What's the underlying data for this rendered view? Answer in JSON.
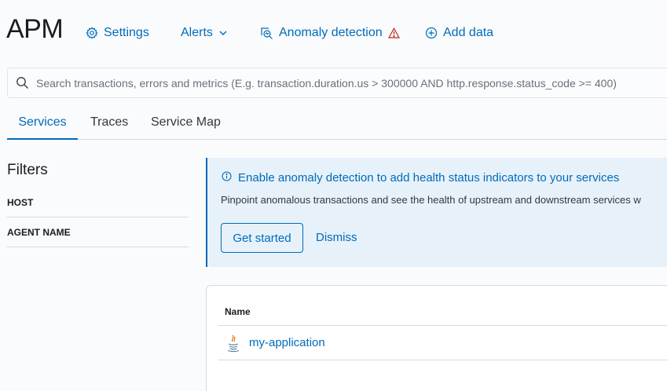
{
  "header": {
    "title": "APM",
    "nav": {
      "settings": "Settings",
      "alerts": "Alerts",
      "anomaly_detection": "Anomaly detection",
      "add_data": "Add data"
    }
  },
  "search": {
    "placeholder": "Search transactions, errors and metrics (E.g. transaction.duration.us > 300000 AND http.response.status_code >= 400)",
    "value": ""
  },
  "tabs": [
    {
      "label": "Services",
      "active": true
    },
    {
      "label": "Traces",
      "active": false
    },
    {
      "label": "Service Map",
      "active": false
    }
  ],
  "filters": {
    "title": "Filters",
    "items": [
      {
        "label": "HOST"
      },
      {
        "label": "AGENT NAME"
      }
    ]
  },
  "callout": {
    "title": "Enable anomaly detection to add health status indicators to your services",
    "body": "Pinpoint anomalous transactions and see the health of upstream and downstream services w",
    "primary_button": "Get started",
    "secondary_button": "Dismiss"
  },
  "services_table": {
    "columns": [
      "Name"
    ],
    "rows": [
      {
        "name": "my-application",
        "agent_icon": "java-icon"
      }
    ]
  },
  "colors": {
    "accent": "#006bb8",
    "warning": "#bd271e",
    "callout_bg": "#e6f1fa",
    "border": "#d3dae6"
  }
}
